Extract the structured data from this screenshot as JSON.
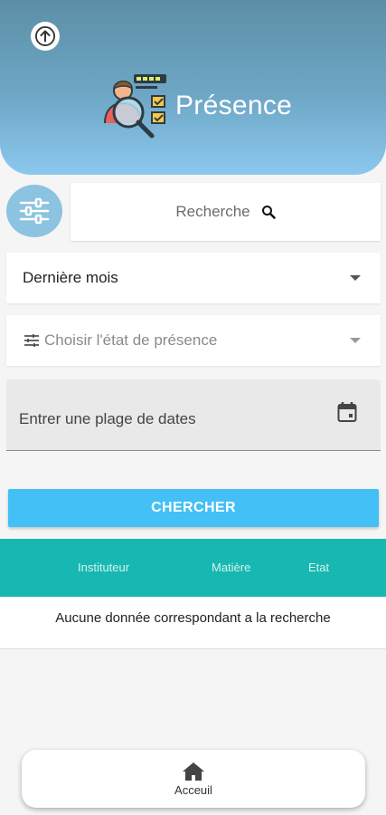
{
  "header": {
    "title": "Présence"
  },
  "search": {
    "placeholder": "Recherche"
  },
  "period_select": {
    "selected": "Dernière mois"
  },
  "status_select": {
    "placeholder": "Choisir l'état de présence"
  },
  "date_range": {
    "placeholder": "Entrer une plage de dates"
  },
  "actions": {
    "search_button": "CHERCHER"
  },
  "table": {
    "columns": [
      "Instituteur",
      "Matière",
      "Etat"
    ],
    "empty_message": "Aucune donnée correspondant a la recherche"
  },
  "bottom_nav": {
    "home_label": "Acceuil"
  },
  "colors": {
    "accent": "#43c0f6",
    "table_header": "#17b8b2",
    "header_gradient_start": "#5c8fa6",
    "header_gradient_end": "#8cc8ee"
  },
  "icons": [
    "arrow-up-icon",
    "attendance-logo-icon",
    "filter-sliders-icon",
    "search-icon",
    "tune-icon",
    "calendar-icon",
    "home-icon"
  ]
}
